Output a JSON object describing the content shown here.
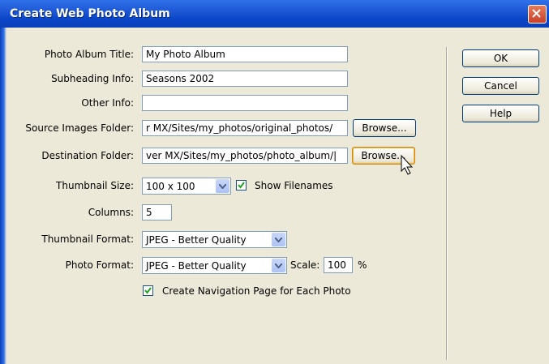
{
  "window": {
    "title": "Create Web Photo Album"
  },
  "labels": {
    "album_title": "Photo Album Title:",
    "subheading": "Subheading Info:",
    "other_info": "Other Info:",
    "source_folder": "Source Images Folder:",
    "dest_folder": "Destination Folder:",
    "thumb_size": "Thumbnail Size:",
    "columns": "Columns:",
    "thumb_format": "Thumbnail Format:",
    "photo_format": "Photo Format:",
    "scale": "Scale:",
    "percent": "%"
  },
  "fields": {
    "album_title": "My Photo Album",
    "subheading": "Seasons 2002",
    "other_info": "",
    "source_folder": "r MX/Sites/my_photos/original_photos/",
    "dest_folder": "ver MX/Sites/my_photos/photo_album/|",
    "columns": "5",
    "scale": "100"
  },
  "selects": {
    "thumb_size": "100 x 100",
    "thumb_format": "JPEG - Better Quality",
    "photo_format": "JPEG - Better Quality"
  },
  "checkboxes": {
    "show_filenames": {
      "label": "Show Filenames",
      "checked": true
    },
    "nav_page": {
      "label": "Create Navigation Page for Each Photo",
      "checked": true
    }
  },
  "buttons": {
    "browse_source": "Browse...",
    "browse_dest": "Browse...",
    "ok": "OK",
    "cancel": "Cancel",
    "help": "Help"
  }
}
